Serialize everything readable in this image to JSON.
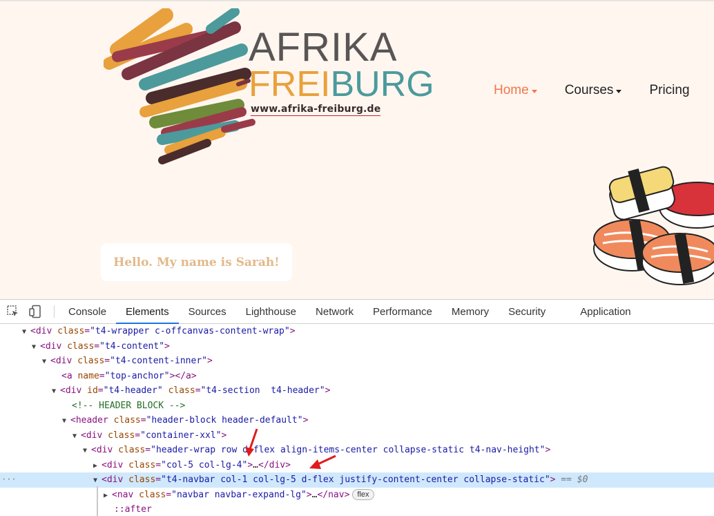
{
  "site": {
    "logo": {
      "line1": "AFRIKA",
      "line2_part1": "FREI",
      "line2_part2": "BURG",
      "url": "www.afrika-freiburg.de"
    },
    "nav": {
      "home": "Home",
      "courses": "Courses",
      "pricing": "Pricing"
    },
    "hello_text": "Hello. My name is Sarah!",
    "colors": {
      "accent": "#f0784a",
      "background": "#fff6f0",
      "hello_text": "#e2b98a"
    }
  },
  "devtools": {
    "icons": [
      "inspect-element-icon",
      "device-toolbar-icon"
    ],
    "tabs": [
      {
        "label": "Console"
      },
      {
        "label": "Elements",
        "active": true
      },
      {
        "label": "Sources"
      },
      {
        "label": "Lighthouse"
      },
      {
        "label": "Network"
      },
      {
        "label": "Performance"
      },
      {
        "label": "Memory"
      },
      {
        "label": "Security"
      },
      {
        "label": "Application"
      }
    ],
    "dom": {
      "l1": {
        "tag": "div",
        "attr": "class",
        "val": "t4-wrapper c-offcanvas-content-wrap"
      },
      "l2": {
        "tag": "div",
        "attr": "class",
        "val": "t4-content"
      },
      "l3": {
        "tag": "div",
        "attr": "class",
        "val": "t4-content-inner"
      },
      "l4": {
        "tag": "a",
        "attr": "name",
        "val": "top-anchor",
        "close": "</a>"
      },
      "l5": {
        "tag": "div",
        "attr1": "id",
        "val1": "t4-header",
        "attr2": "class",
        "val2": "t4-section  t4-header"
      },
      "l6": {
        "comment": "<!-- HEADER BLOCK -->"
      },
      "l7": {
        "tag": "header",
        "attr": "class",
        "val": "header-block header-default"
      },
      "l8": {
        "tag": "div",
        "attr": "class",
        "val": "container-xxl"
      },
      "l9": {
        "tag": "div",
        "attr": "class",
        "val": "header-wrap row d-flex align-items-center collapse-static t4-nav-height"
      },
      "l10": {
        "tag": "div",
        "attr": "class",
        "val": "col-5 col-lg-4",
        "collapsed": "…",
        "close": "</div>"
      },
      "l11": {
        "tag": "div",
        "attr": "class",
        "val": "t4-navbar col-1 col-lg-5 d-flex justify-content-center collapse-static",
        "selected_marker": " == $0"
      },
      "l12": {
        "tag": "nav",
        "attr": "class",
        "val": "navbar navbar-expand-lg",
        "collapsed": "…",
        "close": "</nav>",
        "badge": "flex"
      },
      "l13": {
        "pseudo": "::after"
      }
    }
  }
}
